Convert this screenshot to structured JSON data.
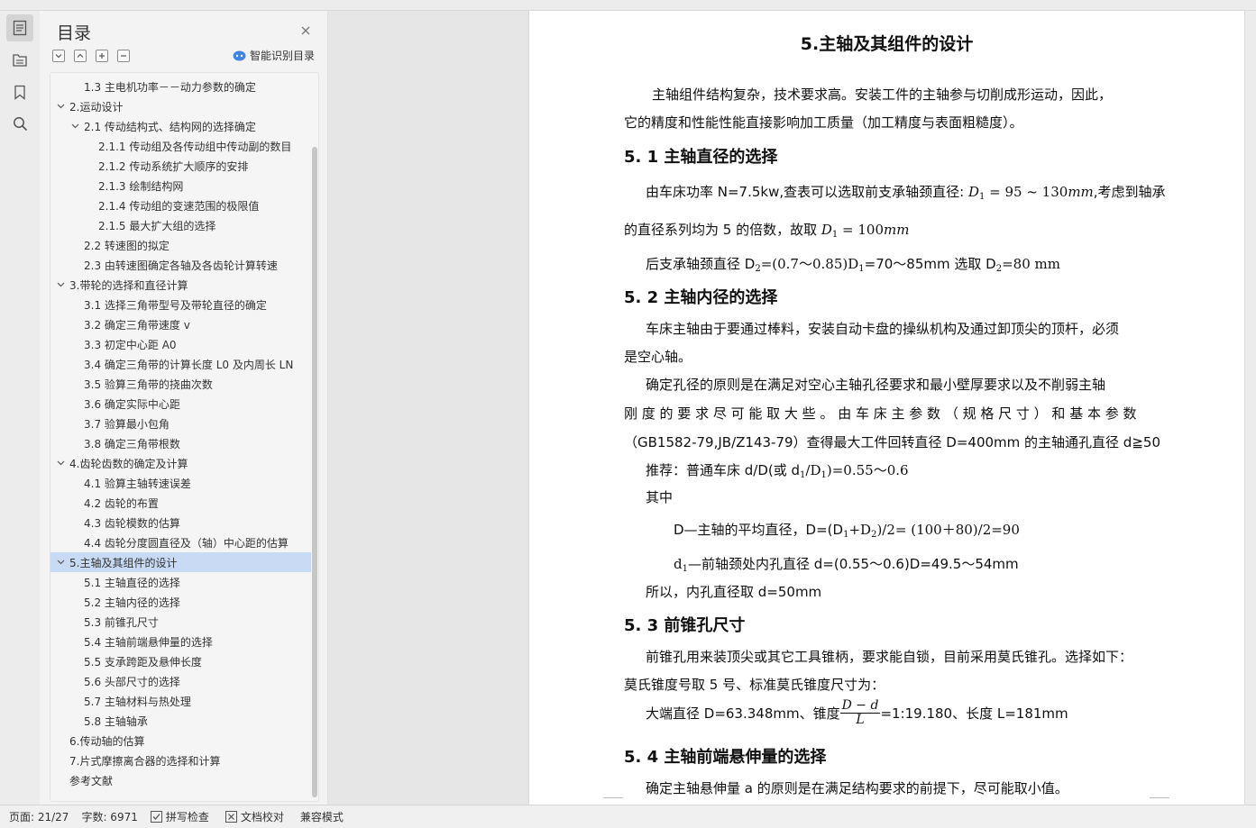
{
  "toc": {
    "title": "目录",
    "smart_label": "智能识别目录",
    "items": [
      {
        "label": "1.3 主电机功率－－动力参数的确定",
        "level": 2,
        "chevron": ""
      },
      {
        "label": "2.运动设计",
        "level": 1,
        "chevron": "down"
      },
      {
        "label": "2.1 传动结构式、结构网的选择确定",
        "level": 2,
        "chevron": "down"
      },
      {
        "label": "2.1.1 传动组及各传动组中传动副的数目",
        "level": 3,
        "chevron": ""
      },
      {
        "label": "2.1.2  传动系统扩大顺序的安排",
        "level": 3,
        "chevron": ""
      },
      {
        "label": "2.1.3  绘制结构网",
        "level": 3,
        "chevron": ""
      },
      {
        "label": "2.1.4  传动组的变速范围的极限值",
        "level": 3,
        "chevron": ""
      },
      {
        "label": "2.1.5 最大扩大组的选择",
        "level": 3,
        "chevron": ""
      },
      {
        "label": "2.2 转速图的拟定",
        "level": 2,
        "chevron": ""
      },
      {
        "label": "2.3  由转速图确定各轴及各齿轮计算转速",
        "level": 2,
        "chevron": ""
      },
      {
        "label": "3.带轮的选择和直径计算",
        "level": 1,
        "chevron": "down"
      },
      {
        "label": "3.1 选择三角带型号及带轮直径的确定",
        "level": 2,
        "chevron": ""
      },
      {
        "label": "3.2 确定三角带速度 v",
        "level": 2,
        "chevron": ""
      },
      {
        "label": "3.3 初定中心距 A0",
        "level": 2,
        "chevron": ""
      },
      {
        "label": "3.4 确定三角带的计算长度 L0 及内周长 LN",
        "level": 2,
        "chevron": ""
      },
      {
        "label": "3.5 验算三角带的挠曲次数",
        "level": 2,
        "chevron": ""
      },
      {
        "label": "3.6 确定实际中心距",
        "level": 2,
        "chevron": ""
      },
      {
        "label": "3.7 验算最小包角",
        "level": 2,
        "chevron": ""
      },
      {
        "label": "3.8 确定三角带根数",
        "level": 2,
        "chevron": ""
      },
      {
        "label": "4.齿轮齿数的确定及计算",
        "level": 1,
        "chevron": "down"
      },
      {
        "label": "4.1 验算主轴转速误差",
        "level": 2,
        "chevron": ""
      },
      {
        "label": "4.2 齿轮的布置",
        "level": 2,
        "chevron": ""
      },
      {
        "label": "4.3  齿轮模数的估算",
        "level": 2,
        "chevron": ""
      },
      {
        "label": "4.4  齿轮分度圆直径及（轴）中心距的估算",
        "level": 2,
        "chevron": ""
      },
      {
        "label": "5.主轴及其组件的设计",
        "level": 1,
        "chevron": "down",
        "selected": true
      },
      {
        "label": "5.1 主轴直径的选择",
        "level": 2,
        "chevron": ""
      },
      {
        "label": "5.2 主轴内径的选择",
        "level": 2,
        "chevron": ""
      },
      {
        "label": "5.3 前锥孔尺寸",
        "level": 2,
        "chevron": ""
      },
      {
        "label": "5.4 主轴前端悬伸量的选择",
        "level": 2,
        "chevron": ""
      },
      {
        "label": "5.5 支承跨距及悬伸长度",
        "level": 2,
        "chevron": ""
      },
      {
        "label": "5.6 头部尺寸的选择",
        "level": 2,
        "chevron": ""
      },
      {
        "label": "5.7 主轴材料与热处理",
        "level": 2,
        "chevron": ""
      },
      {
        "label": "5.8 主轴轴承",
        "level": 2,
        "chevron": ""
      },
      {
        "label": "6.传动轴的估算",
        "level": 1,
        "chevron": ""
      },
      {
        "label": "7.片式摩擦离合器的选择和计算",
        "level": 1,
        "chevron": ""
      },
      {
        "label": "参考文献",
        "level": 1,
        "chevron": ""
      }
    ]
  },
  "doc": {
    "title": "5.主轴及其组件的设计",
    "intro_1": "主轴组件结构复杂，技术要求高。安装工件的主轴参与切削成形运动，因此，",
    "intro_2": "它的精度和性能性能直接影响加工质量（加工精度与表面粗糙度）。",
    "h_5_1": "5. 1 主轴直径的选择",
    "p511_a": "由车床功率 N=7.5kw,查表可以选取前支承轴颈直径: ",
    "p511_D": "D",
    "p511_sub": "1",
    "p511_b": " = 95 ~ 130",
    "p511_mm": "mm",
    "p511_c": ",考虑到轴承",
    "p512_a": "的直径系列均为 5 的倍数，故取 ",
    "p512_D": "D",
    "p512_sub": "1",
    "p512_b": " = 100",
    "p512_mm": "mm",
    "p513_a": "后支承轴颈直径  D",
    "p513_s1": "2",
    "p513_b": "=(0.7～0.85)D",
    "p513_s2": "1",
    "p513_c": "=70～85mm  选取  D",
    "p513_s3": "2",
    "p513_d": "=80 mm",
    "h_5_2": "5. 2 主轴内径的选择",
    "p521": "车床主轴由于要通过棒料，安装自动卡盘的操纵机构及通过卸顶尖的顶杆，必须",
    "p522": "是空心轴。",
    "p523": "确定孔径的原则是在满足对空心主轴孔径要求和最小壁厚要求以及不削弱主轴",
    "p524": "刚 度 的 要 求 尽 可 能 取 大 些 。 由 车 床 主 参 数 （ 规 格 尺 寸 ） 和 基 本 参 数",
    "p525": "（GB1582-79,JB/Z143-79）查得最大工件回转直径 D=400mm 的主轴通孔直径 d≧50",
    "p526_a": "推荐：普通车床 d/D(或 d",
    "p526_s1": "1",
    "p526_b": "/D",
    "p526_s2": "1",
    "p526_c": ")=0.55～0.6",
    "p527": "其中",
    "p528_a": "D—主轴的平均直径，D=(D",
    "p528_s1": "1",
    "p528_b": "+D",
    "p528_s2": "2",
    "p528_c": ")/2= (100＋80)/2=90",
    "p529_a": "d",
    "p529_s1": "1",
    "p529_b": "—前轴颈处内孔直径 d=(0.55～0.6)D=49.5～54mm",
    "p5210": "所以，内孔直径取 d=50mm",
    "h_5_3": "5. 3 前锥孔尺寸",
    "p531": "前锥孔用来装顶尖或其它工具锥柄，要求能自锁，目前采用莫氏锥孔。选择如下：",
    "p532": "莫氏锥度号取 5 号、标准莫氏锥度尺寸为：",
    "p533_a": "大端直径  D=63.348mm、锥度",
    "p533_num": "D − d",
    "p533_den": "L",
    "p533_b": "=1:19.180、长度 L=181mm",
    "h_5_4": "5. 4 主轴前端悬伸量的选择",
    "p541": "确定主轴悬伸量 a 的原则是在满足结构要求的前提下，尽可能取小值。"
  },
  "status": {
    "page": "页面: 21/27",
    "words": "字数: 6971",
    "spell": "拼写检查",
    "proof": "文档校对",
    "compat": "兼容模式"
  }
}
